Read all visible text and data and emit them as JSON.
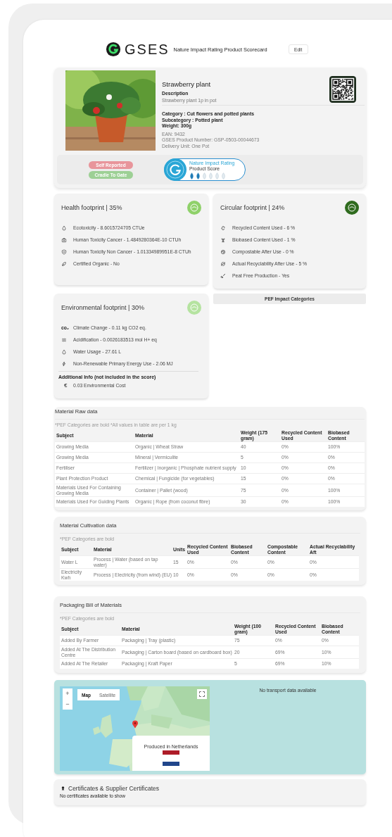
{
  "header": {
    "brand": "GSES",
    "title": "Nature Impact Rating Product Scorecard",
    "edit_button": "Edit"
  },
  "product": {
    "name": "Strawberry plant",
    "description_label": "Description",
    "description": "Strawberry plant 1p in pot",
    "category": "Category : Cut flowers and potted plants",
    "subcategory": "Subcategory : Potted plant",
    "weight": "Weight: 300g",
    "ean": "EAN: 9432",
    "product_number": "GSES Product Number: GSP-0503-00044673",
    "delivery_unit": "Delivery Unit: One Pot"
  },
  "tags": [
    {
      "label": "Self Reported",
      "color": "#e8959b"
    },
    {
      "label": "Cradle To Gate",
      "color": "#9dd095"
    }
  ],
  "rating": {
    "title": "Nature Impact Rating",
    "subtitle": "Product Score",
    "stars": 2
  },
  "footprints": [
    {
      "title": "Health footprint | 35%",
      "color": "#8fd16a",
      "items": [
        {
          "text": "Ecotoxicity - 8.6015724705 CTUe"
        },
        {
          "text": "Human Toxicity Cancer - 1.4849280364E-10 CTUh"
        },
        {
          "text": "Human Toxicity Non Cancer - 1.01334989951E-8 CTUh"
        },
        {
          "text": "Certified Organic - No"
        }
      ]
    },
    {
      "title": "Circular footprint | 24%",
      "color": "#2f6b1e",
      "items": [
        {
          "text": "Recycled Content Used - 6 %"
        },
        {
          "text": "Biobased Content Used - 1 %"
        },
        {
          "text": "Compostable After Use - 0 %"
        },
        {
          "text": "Actual Recyclability After Use - 5 %"
        },
        {
          "text": "Peat Free Production - Yes"
        }
      ]
    },
    {
      "title": "Environmental footprint | 30%",
      "color": "#b5e3a0",
      "items": [
        {
          "symbol": "co₂",
          "text": "Climate Change - 0.11 kg CO2 eq."
        },
        {
          "text": "Acidification - 0.0026183513 mol H+ eq"
        },
        {
          "text": "Water Usage - 27.61 L"
        },
        {
          "text": "Non-Renewable Primary Energy Use - 2.06 MJ"
        }
      ],
      "additional_title": "Additional Info (not included in the score)",
      "additional_items": [
        {
          "symbol": "€",
          "text": "0.03 Environmental Cost"
        }
      ]
    }
  ],
  "pef_button": "PEF Impact Categories",
  "tables": [
    {
      "title": "Material Raw data",
      "note": "*PEF Categories are bold  *All values in table are per 1 kg",
      "columns": [
        "Subject",
        "Material",
        "Weight (175 gram)",
        "Recycled Content Used",
        "Biobased Content"
      ],
      "rows": [
        [
          "Growing Media",
          "Organic | Wheat Straw",
          "40",
          "0%",
          "100%"
        ],
        [
          "Growing Media",
          "Mineral | Vermiculite",
          "5",
          "0%",
          "0%"
        ],
        [
          "Fertiliser",
          "Fertilizer | Inorganic | Phosphate nutrient supply",
          "10",
          "0%",
          "0%"
        ],
        [
          "Plant Protection Product",
          "Chemical | Fungicide (for vegetables)",
          "15",
          "0%",
          "0%"
        ],
        [
          "Materials Used For Containing Growing Media",
          "Container | Pallet (wood)",
          "75",
          "0%",
          "100%"
        ],
        [
          "Materials Used For Guiding Plants",
          "Organic | Rope (from coconut fibre)",
          "30",
          "0%",
          "100%"
        ]
      ]
    },
    {
      "title": "Material Cultivation data",
      "note": "*PEF Categories are bold",
      "columns": [
        "Subject",
        "Material",
        "Units",
        "Recycled Content Used",
        "Biobased Content",
        "Compostable Content",
        "Actual Recyclability Aft"
      ],
      "rows": [
        [
          "Water L",
          "Process | Water (based on tap water)",
          "15",
          "0%",
          "0%",
          "0%",
          "0%"
        ],
        [
          "Electricity Kwh",
          "Process | Electricity (from wind) (EU)",
          "10",
          "0%",
          "0%",
          "0%",
          "0%"
        ]
      ]
    },
    {
      "title": "Packaging Bill of Materials",
      "note": "*PEF Categories are bold",
      "columns": [
        "Subject",
        "Material",
        "Weight (100 gram)",
        "Recycled Content Used",
        "Biobased Content"
      ],
      "rows": [
        [
          "Added By Farmer",
          "Packaging | Tray (plastic)",
          "75",
          "0%",
          "0%"
        ],
        [
          "Added At The Distribution Centre",
          "Packaging | Carton board (based on cardboard box)",
          "20",
          "69%",
          "10%"
        ],
        [
          "Added At The Retailer",
          "Packaging | Kraft Paper",
          "5",
          "69%",
          "10%"
        ]
      ]
    }
  ],
  "map": {
    "zoom_in": "+",
    "zoom_out": "−",
    "map_types": [
      {
        "label": "Map",
        "selected": true
      },
      {
        "label": "Satellite",
        "selected": false
      }
    ],
    "info": "Produced in Netherlands",
    "transport_note": "No transport data available"
  },
  "certificates": {
    "title": "Certificates & Supplier Certificates",
    "empty": "No certificates available to show"
  }
}
